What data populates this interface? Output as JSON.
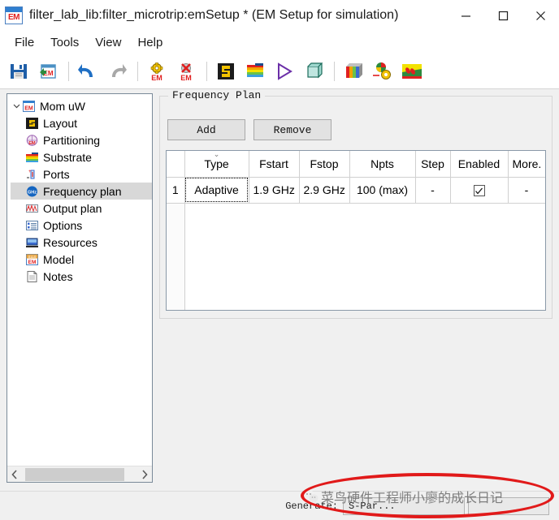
{
  "window": {
    "icon": "em-app-icon",
    "title": "filter_lab_lib:filter_microtrip:emSetup * (EM Setup for simulation)",
    "minimize_label": "minimize-icon",
    "maximize_label": "maximize-icon",
    "close_label": "close-icon"
  },
  "menu": {
    "items": [
      {
        "label": "File"
      },
      {
        "label": "Tools"
      },
      {
        "label": "View"
      },
      {
        "label": "Help"
      }
    ]
  },
  "toolbar": {
    "buttons": [
      {
        "icon": "save-icon",
        "tooltip": "Save"
      },
      {
        "icon": "save-em-setup-icon",
        "tooltip": "Save EM Setup"
      },
      {
        "icon": "undo-icon",
        "tooltip": "Undo"
      },
      {
        "icon": "redo-icon",
        "tooltip": "Redo"
      },
      {
        "icon": "simulate-em-icon",
        "tooltip": "Simulate EM"
      },
      {
        "icon": "stop-em-icon",
        "tooltip": "Stop EM"
      },
      {
        "icon": "layout-icon",
        "tooltip": "Layout"
      },
      {
        "icon": "substrate-icon",
        "tooltip": "Substrate"
      },
      {
        "icon": "run-icon",
        "tooltip": "Run"
      },
      {
        "icon": "3d-view-icon",
        "tooltip": "3D View"
      },
      {
        "icon": "mesh-cube-icon",
        "tooltip": "Mesh"
      },
      {
        "icon": "visualization-icon",
        "tooltip": "Visualization"
      },
      {
        "icon": "em-result-icon",
        "tooltip": "EM Result"
      }
    ]
  },
  "tree": {
    "root": {
      "label": "Mom uW",
      "icon": "em-icon",
      "expanded": true
    },
    "items": [
      {
        "label": "Layout",
        "icon": "layout-icon",
        "selected": false
      },
      {
        "label": "Partitioning",
        "icon": "partitioning-icon",
        "selected": false
      },
      {
        "label": "Substrate",
        "icon": "substrate-icon",
        "selected": false
      },
      {
        "label": "Ports",
        "icon": "ports-icon",
        "selected": false
      },
      {
        "label": "Frequency plan",
        "icon": "ghz-icon",
        "selected": true
      },
      {
        "label": "Output plan",
        "icon": "waveform-icon",
        "selected": false
      },
      {
        "label": "Options",
        "icon": "options-list-icon",
        "selected": false
      },
      {
        "label": "Resources",
        "icon": "monitor-icon",
        "selected": false
      },
      {
        "label": "Model",
        "icon": "model-em-icon",
        "selected": false
      },
      {
        "label": "Notes",
        "icon": "document-icon",
        "selected": false
      }
    ],
    "scroll_left_icon": "chevron-left-icon",
    "scroll_right_icon": "chevron-right-icon"
  },
  "frequency_plan": {
    "group_title": "Frequency Plan",
    "add_label": "Add",
    "remove_label": "Remove",
    "columns": [
      "",
      "Type",
      "Fstart",
      "Fstop",
      "Npts",
      "Step",
      "Enabled",
      "More."
    ],
    "rows": [
      {
        "index": "1",
        "type": "Adaptive",
        "fstart": "1.9 GHz",
        "fstop": "2.9 GHz",
        "npts": "100 (max)",
        "step": "-",
        "enabled": true,
        "more": "-"
      }
    ]
  },
  "status": {
    "label": "Generate:",
    "combo1_value": "S-Par...",
    "combo2_value": ""
  },
  "watermark": {
    "logo": "wechat-logo-icon",
    "text": "菜鸟硬件工程师小廖的成长日记"
  },
  "colors": {
    "selection": "#d8d8d8",
    "annotation_red": "#e11a1a",
    "accent_blue": "#2f7fd0",
    "em_red": "#e02020"
  }
}
